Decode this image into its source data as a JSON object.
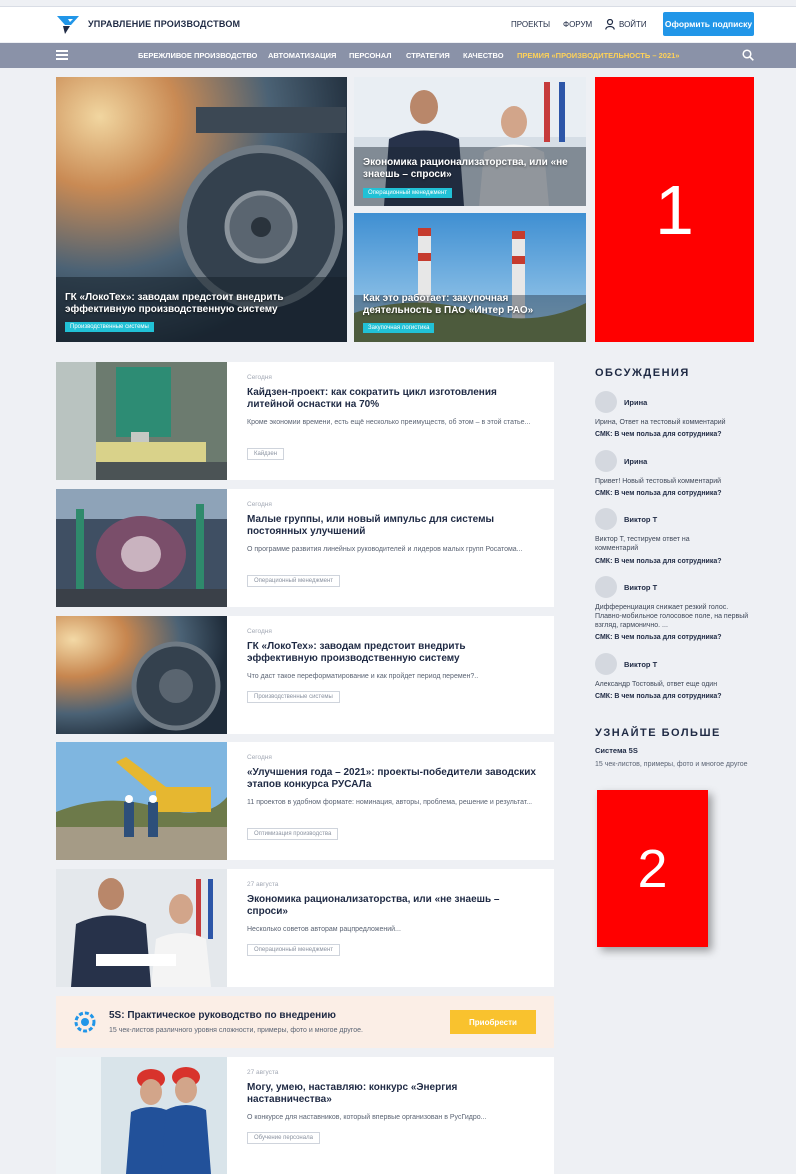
{
  "header": {
    "brand": "УПРАВЛЕНИЕ ПРОИЗВОДСТВОМ",
    "links": [
      "ПРОЕКТЫ",
      "ФОРУМ"
    ],
    "login": "ВОЙТИ",
    "subscribe": "Оформить подписку",
    "accent_color": "#2196e8"
  },
  "nav": {
    "items": [
      "БЕРЕЖЛИВОЕ ПРОИЗВОДСТВО",
      "АВТОМАТИЗАЦИЯ",
      "ПЕРСОНАЛ",
      "СТРАТЕГИЯ",
      "КАЧЕСТВО"
    ],
    "premium": "ПРЕМИЯ «ПРОИЗВОДИТЕЛЬНОСТЬ – 2021»",
    "bar_color": "#8a92a8"
  },
  "hero": {
    "main": {
      "title": "ГК «ЛокоТех»: заводам предстоит внедрить эффективную производственную систему",
      "tag": "Производственные системы"
    },
    "top_right": {
      "title": "Экономика рационализаторства, или «не знаешь – спроси»",
      "tag": "Операционный менеджмент"
    },
    "bottom_right": {
      "title": "Как это работает: закупочная деятельность в ПАО «Интер РАО»",
      "tag": "Закупочная логистика"
    },
    "ad1": "1"
  },
  "articles": [
    {
      "date": "Сегодня",
      "title": "Кайдзен-проект: как сократить цикл изготовления литейной оснастки на 70%",
      "desc": "Кроме экономии времени, есть ещё несколько преимуществ, об этом – в этой статье...",
      "tag": "Кайдзен"
    },
    {
      "date": "Сегодня",
      "title": "Малые группы, или новый импульс для системы постоянных улучшений",
      "desc": "О программе развития линейных руководителей и лидеров малых групп Росатома...",
      "tag": "Операционный менеджмент"
    },
    {
      "date": "Сегодня",
      "title": "ГК «ЛокоТех»: заводам предстоит внедрить эффективную производственную систему",
      "desc": "Что даст такое переформатирование и как пройдет период перемен?..",
      "tag": "Производственные системы"
    },
    {
      "date": "Сегодня",
      "title": "«Улучшения года – 2021»: проекты-победители заводских этапов конкурса РУСАЛа",
      "desc": "11 проектов в удобном формате: номинация, авторы, проблема, решение и результат...",
      "tag": "Оптимизация производства"
    },
    {
      "date": "27 августа",
      "title": "Экономика рационализаторства, или «не знаешь – спроси»",
      "desc": "Несколько советов авторам рацпредложений...",
      "tag": "Операционный менеджмент"
    },
    {
      "date": "27 августа",
      "title": "Могу, умею, наставляю: конкурс «Энергия наставничества»",
      "desc": "О конкурсе для наставников, который впервые организован в РусГидро...",
      "tag": "Обучение персонала"
    }
  ],
  "promo": {
    "title": "5S: Практическое руководство по внедрению",
    "desc": "15 чек-листов различного уровня сложности, примеры, фото и многое другое.",
    "button": "Приобрести"
  },
  "sidebar": {
    "discussions_heading": "ОБСУЖДЕНИЯ",
    "comments": [
      {
        "name": "Ирина",
        "text": "Ирина, Ответ на тестовый комментарий",
        "link": "СМК: В чем польза для сотрудника?"
      },
      {
        "name": "Ирина",
        "text": "Привет! Новый тестовый комментарий",
        "link": "СМК: В чем польза для сотрудника?"
      },
      {
        "name": "Виктор Т",
        "text": "Виктор Т, тестируем ответ на комментарий",
        "link": "СМК: В чем польза для сотрудника?"
      },
      {
        "name": "Виктор Т",
        "text": "Дифференциация снижает резкий голос. Плавно-мобильное голосовое поле, на первый взгляд, гармонично. ...",
        "link": "СМК: В чем польза для сотрудника?"
      },
      {
        "name": "Виктор Т",
        "text": "Александр Тостовый, ответ еще один",
        "link": "СМК: В чем польза для сотрудника?"
      }
    ],
    "learn_heading": "УЗНАЙТЕ БОЛЬШЕ",
    "learn_title": "Система 5S",
    "learn_desc": "15 чек-листов, примеры, фото и многое другое",
    "ad2": "2"
  }
}
